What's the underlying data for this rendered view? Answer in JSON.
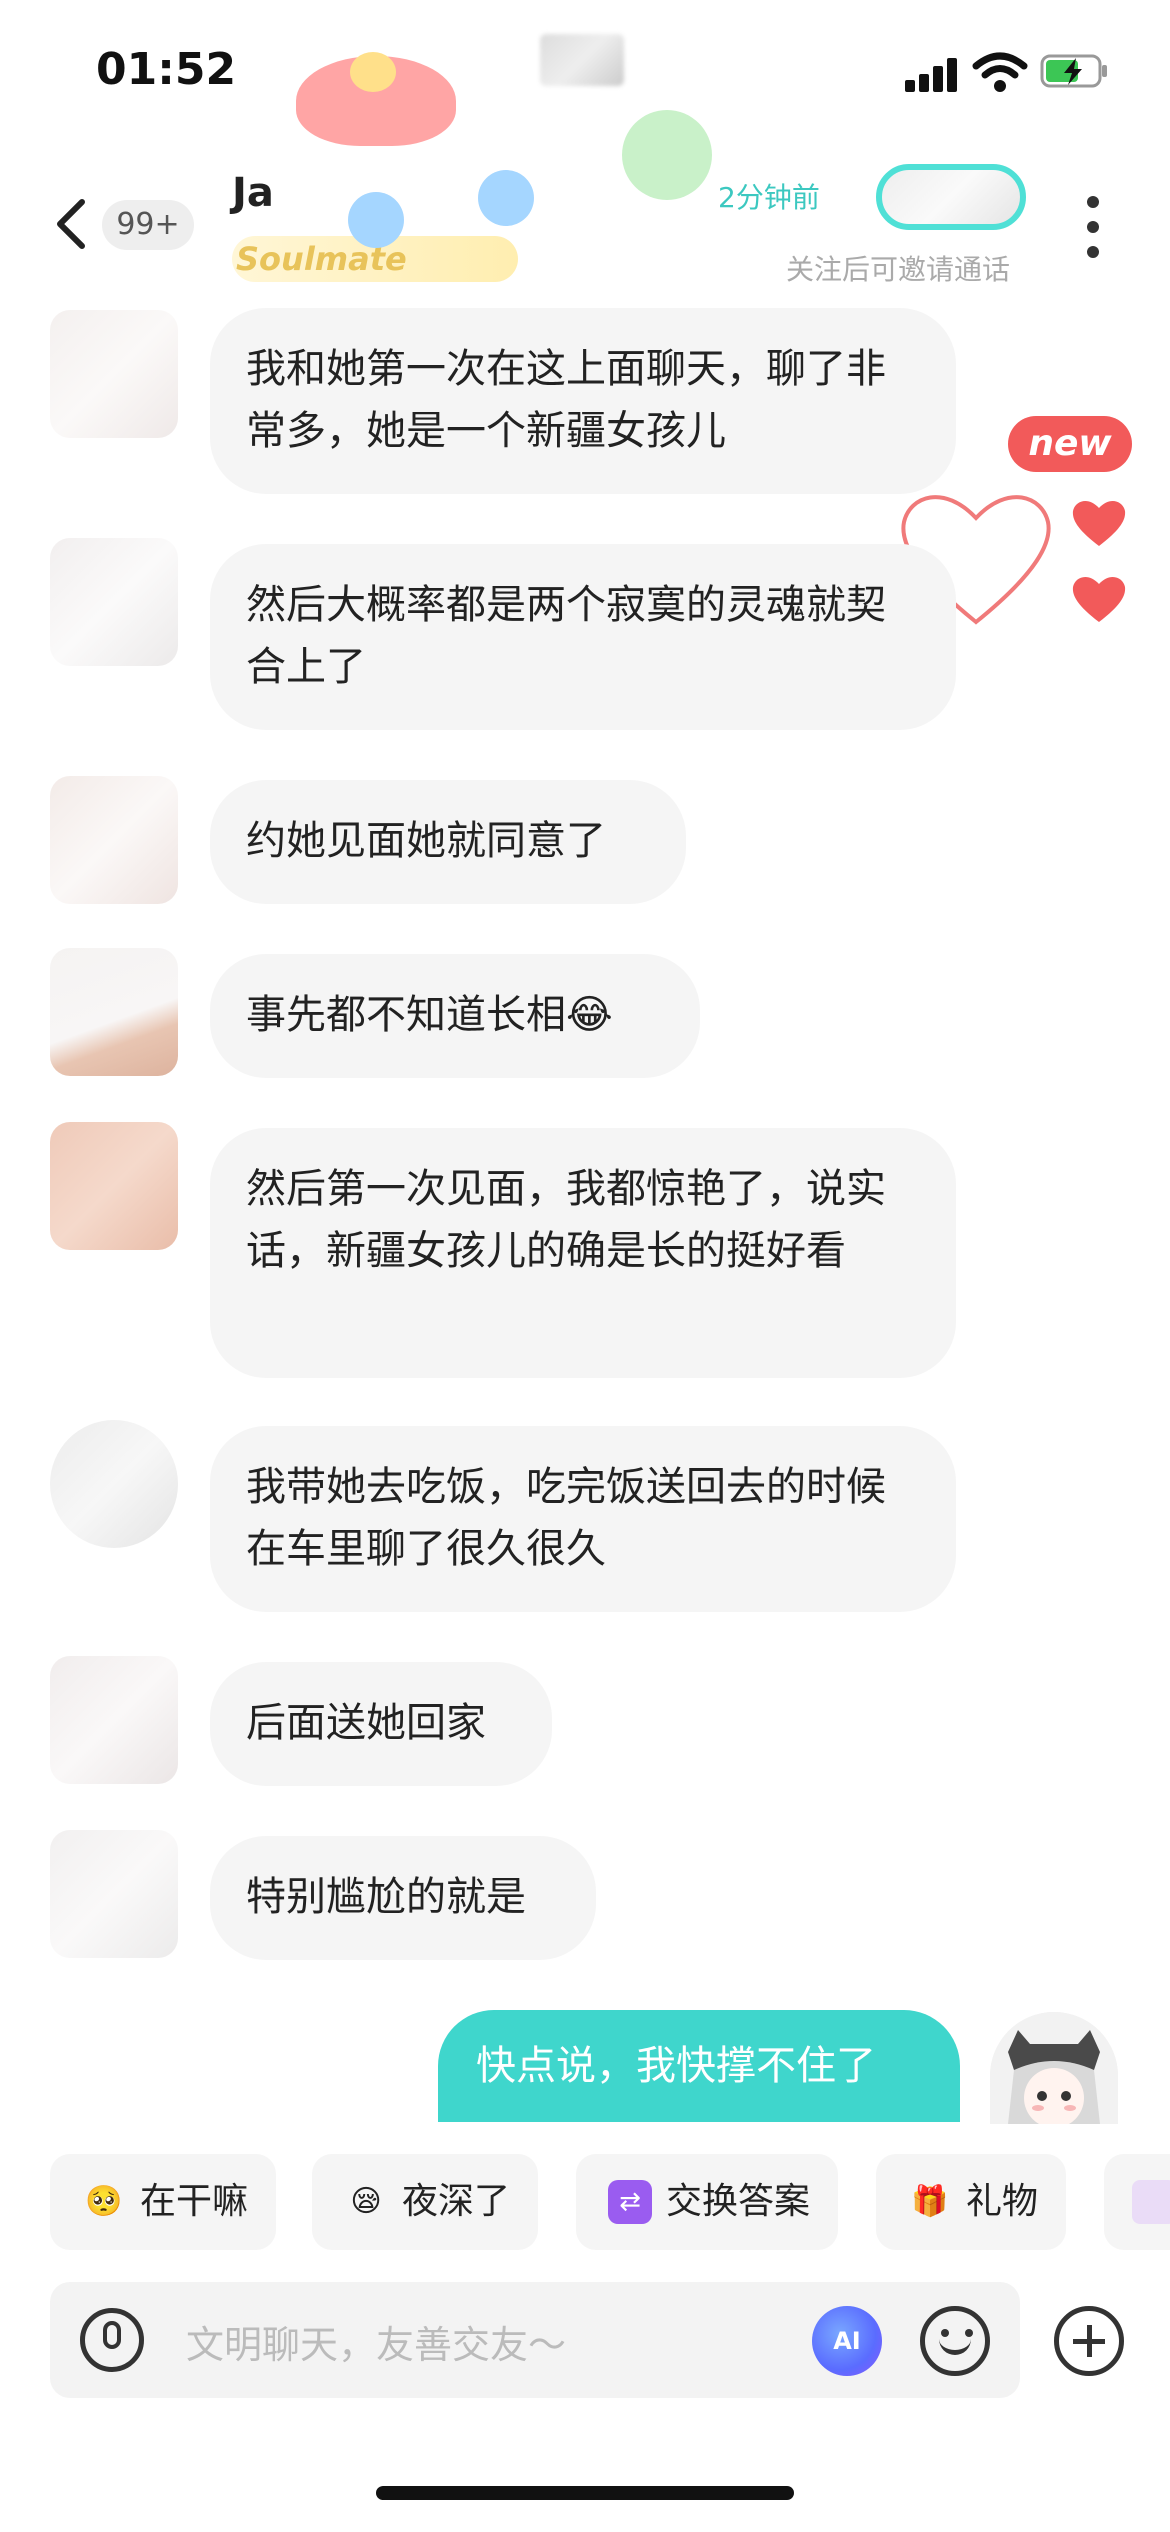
{
  "status": {
    "time": "01:52"
  },
  "header": {
    "badge": "99+",
    "name": "Ja",
    "tag": "Soulmate",
    "online": "2分钟前",
    "follow_hint": "关注后可邀请通话"
  },
  "decor": {
    "new_label": "new"
  },
  "messages": [
    {
      "text": "我和她第一次在这上面聊天，聊了非常多，她是一个新疆女孩儿"
    },
    {
      "text": "然后大概率都是两个寂寞的灵魂就契合上了"
    },
    {
      "text": "约她见面她就同意了"
    },
    {
      "text": "事先都不知道长相😂"
    },
    {
      "text": "然后第一次见面，我都惊艳了，说实话，新疆女孩儿的确是长的挺好看"
    },
    {
      "text": "我带她去吃饭，吃完饭送回去的时候在车里聊了很久很久"
    },
    {
      "text": "后面送她回家"
    },
    {
      "text": "特别尴尬的就是"
    }
  ],
  "my_message": {
    "text": "快点说，我快撑不住了"
  },
  "quick_replies": [
    {
      "icon": "🥺",
      "label": "在干嘛"
    },
    {
      "icon": "😪",
      "label": "夜深了"
    },
    {
      "icon": "⇄",
      "label": "交换答案"
    },
    {
      "icon": "🎁",
      "label": "礼物"
    }
  ],
  "input": {
    "placeholder": "文明聊天，友善交友～",
    "ai_label": "AI"
  },
  "colors": {
    "accent": "#3fd6cc",
    "bubble": "#f5f5f5",
    "heart": "#f25a5a"
  }
}
